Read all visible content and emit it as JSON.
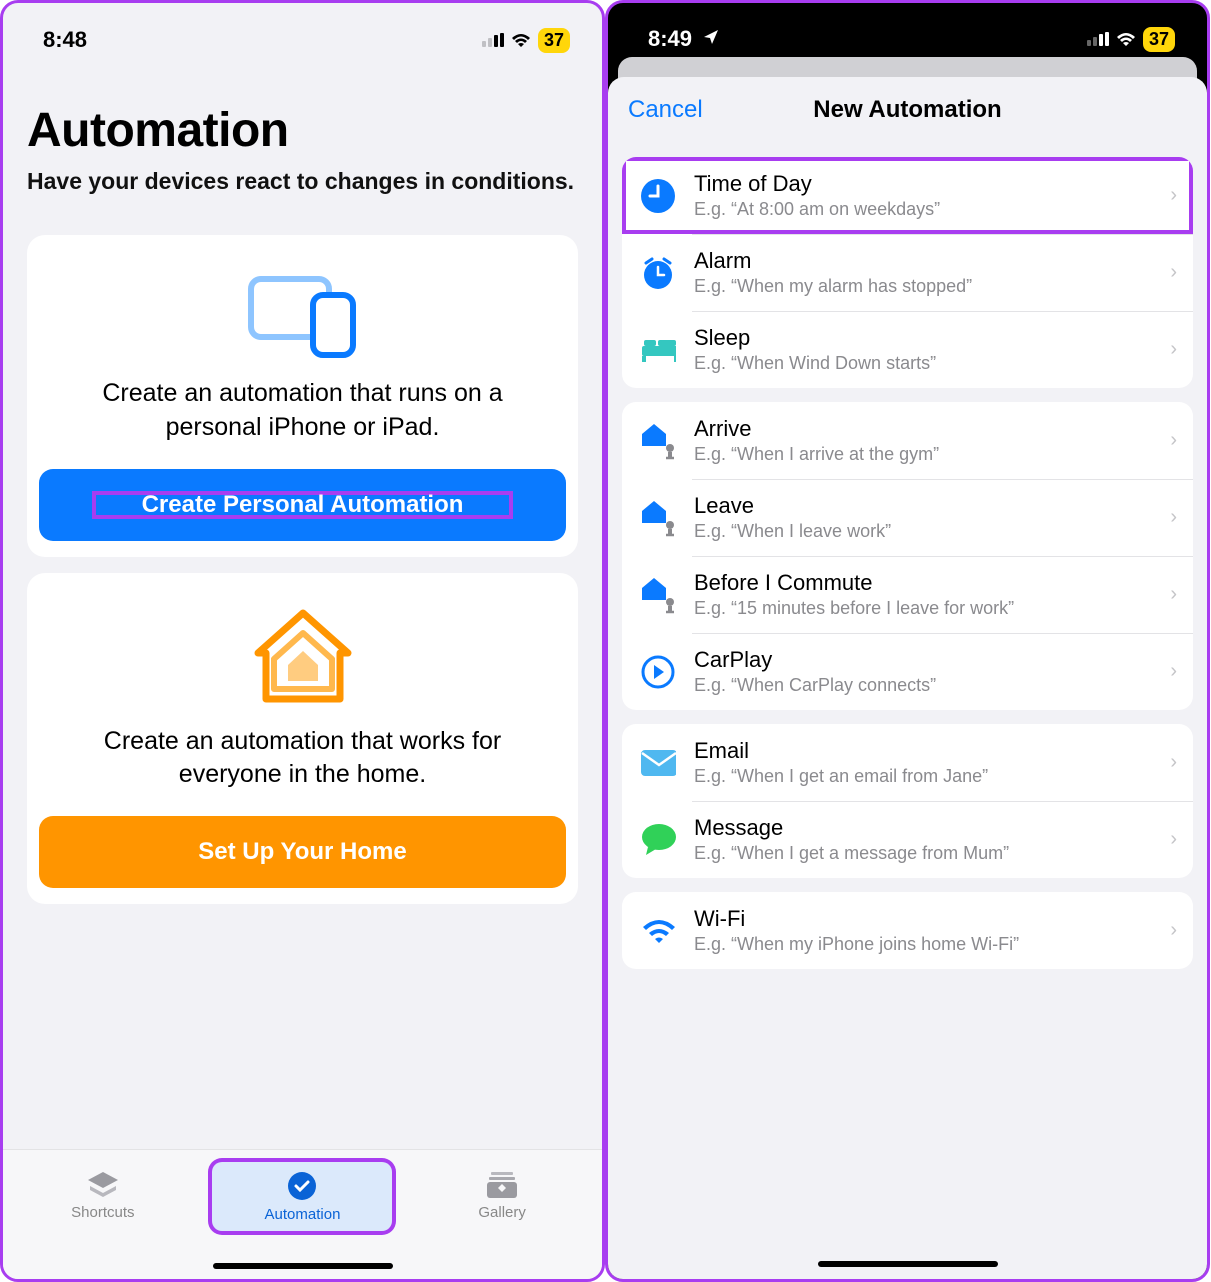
{
  "left": {
    "status": {
      "time": "8:48",
      "battery": "37"
    },
    "title": "Automation",
    "subtitle": "Have your devices react to changes in conditions.",
    "card_personal": {
      "text": "Create an automation that runs on a personal iPhone or iPad.",
      "button": "Create Personal Automation"
    },
    "card_home": {
      "text": "Create an automation that works for everyone in the home.",
      "button": "Set Up Your Home"
    },
    "tabs": {
      "shortcuts": "Shortcuts",
      "automation": "Automation",
      "gallery": "Gallery"
    }
  },
  "right": {
    "status": {
      "time": "8:49",
      "battery": "37"
    },
    "cancel": "Cancel",
    "title": "New Automation",
    "sections": [
      [
        {
          "title": "Time of Day",
          "sub": "E.g. “At 8:00 am on weekdays”"
        },
        {
          "title": "Alarm",
          "sub": "E.g. “When my alarm has stopped”"
        },
        {
          "title": "Sleep",
          "sub": "E.g. “When Wind Down starts”"
        }
      ],
      [
        {
          "title": "Arrive",
          "sub": "E.g. “When I arrive at the gym”"
        },
        {
          "title": "Leave",
          "sub": "E.g. “When I leave work”"
        },
        {
          "title": "Before I Commute",
          "sub": "E.g. “15 minutes before I leave for work”"
        },
        {
          "title": "CarPlay",
          "sub": "E.g. “When CarPlay connects”"
        }
      ],
      [
        {
          "title": "Email",
          "sub": "E.g. “When I get an email from Jane”"
        },
        {
          "title": "Message",
          "sub": "E.g. “When I get a message from Mum”"
        }
      ],
      [
        {
          "title": "Wi-Fi",
          "sub": "E.g. “When my iPhone joins home Wi-Fi”"
        }
      ]
    ]
  }
}
